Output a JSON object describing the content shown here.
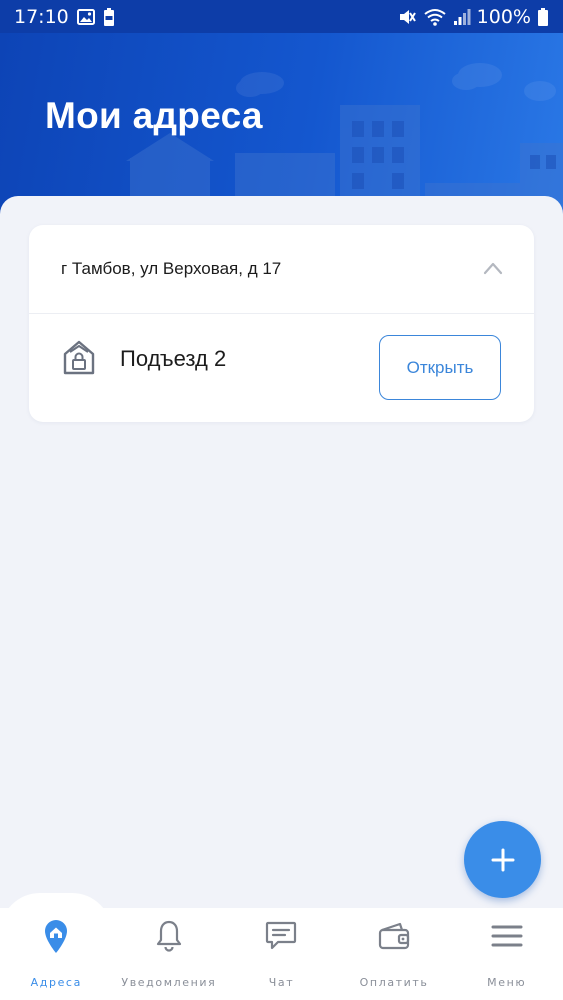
{
  "status_bar": {
    "time": "17:10",
    "battery_percent": "100%",
    "icons": [
      "image-icon",
      "battery-saver-icon",
      "mute-icon",
      "wifi-icon",
      "signal-icon",
      "battery-icon"
    ]
  },
  "header": {
    "title": "Мои адреса"
  },
  "address_card": {
    "address": "г Тамбов, ул Верховая, д 17",
    "expanded": true,
    "entrances": [
      {
        "label": "Подъезд 2",
        "action_label": "Открыть"
      }
    ]
  },
  "fab": {
    "icon": "plus-icon"
  },
  "bottom_nav": {
    "active": "addresses",
    "items": [
      {
        "id": "addresses",
        "label": "Адреса",
        "icon": "home-pin-icon"
      },
      {
        "id": "notifications",
        "label": "Уведомления",
        "icon": "bell-icon"
      },
      {
        "id": "chat",
        "label": "Чат",
        "icon": "chat-icon"
      },
      {
        "id": "pay",
        "label": "Оплатить",
        "icon": "wallet-icon"
      },
      {
        "id": "menu",
        "label": "Меню",
        "icon": "menu-icon"
      }
    ]
  },
  "colors": {
    "header_gradient_start": "#0d44b6",
    "header_gradient_end": "#2a78e6",
    "accent": "#3a8de8",
    "background": "#f1f3f9",
    "nav_inactive": "#8a8f99"
  }
}
